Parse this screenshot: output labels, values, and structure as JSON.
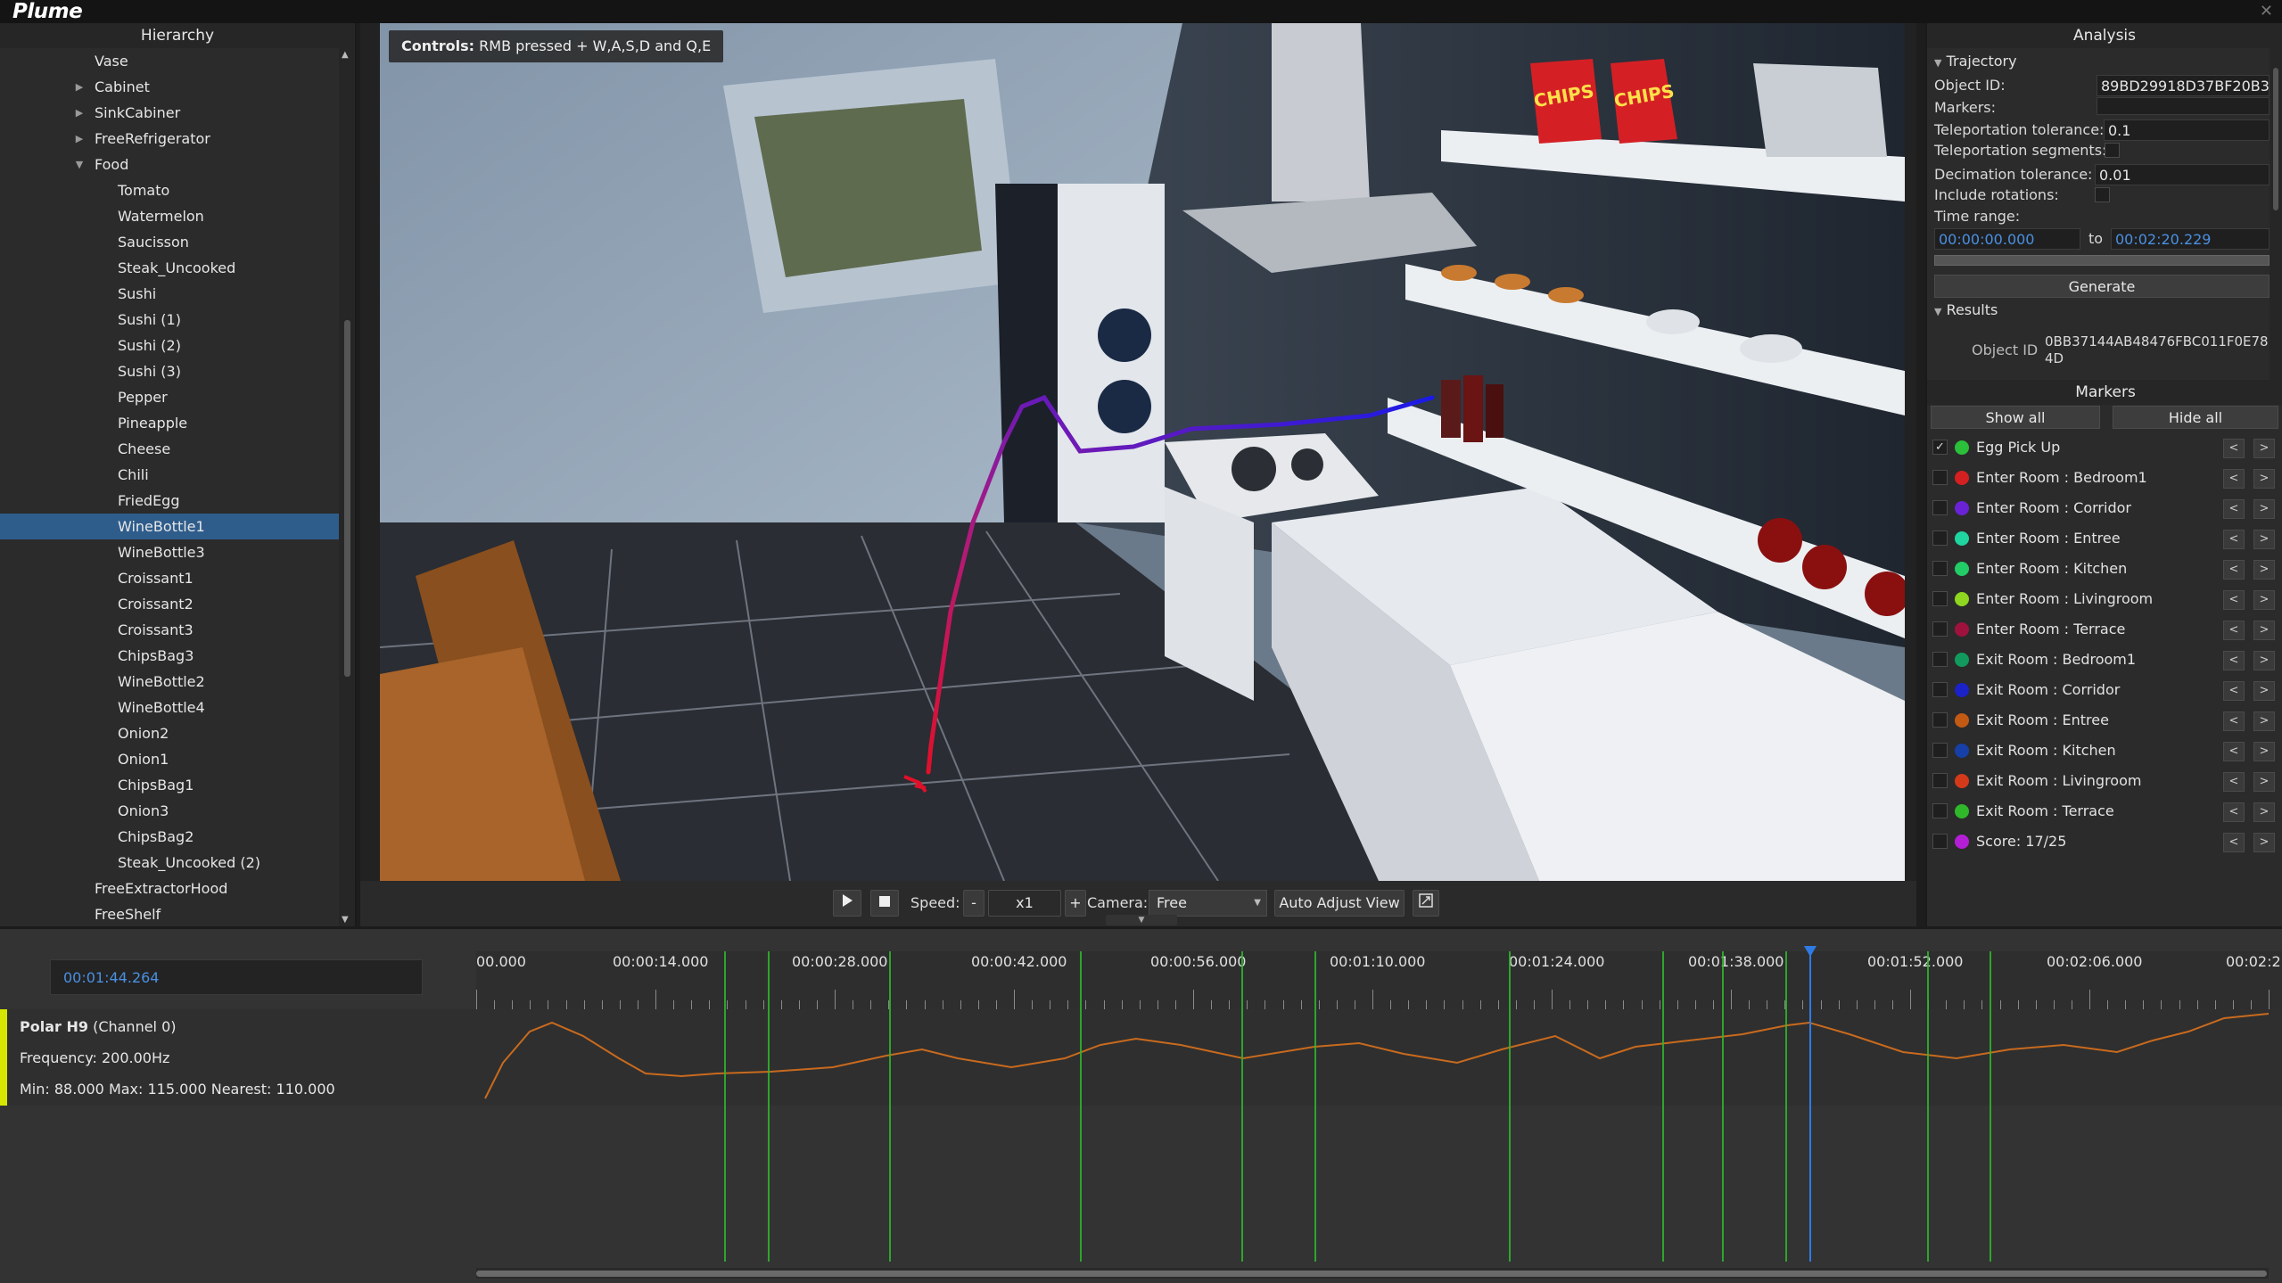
{
  "app": {
    "logo": "Plume"
  },
  "hierarchy": {
    "title": "Hierarchy",
    "items": [
      {
        "label": "Vase",
        "depth": 1,
        "arrow": ""
      },
      {
        "label": "Cabinet",
        "depth": 1,
        "arrow": "right"
      },
      {
        "label": "SinkCabiner",
        "depth": 1,
        "arrow": "right"
      },
      {
        "label": "FreeRefrigerator",
        "depth": 1,
        "arrow": "right"
      },
      {
        "label": "Food",
        "depth": 1,
        "arrow": "down"
      },
      {
        "label": "Tomato",
        "depth": 2,
        "arrow": ""
      },
      {
        "label": "Watermelon",
        "depth": 2,
        "arrow": ""
      },
      {
        "label": "Saucisson",
        "depth": 2,
        "arrow": ""
      },
      {
        "label": "Steak_Uncooked",
        "depth": 2,
        "arrow": ""
      },
      {
        "label": "Sushi",
        "depth": 2,
        "arrow": ""
      },
      {
        "label": "Sushi (1)",
        "depth": 2,
        "arrow": ""
      },
      {
        "label": "Sushi (2)",
        "depth": 2,
        "arrow": ""
      },
      {
        "label": "Sushi (3)",
        "depth": 2,
        "arrow": ""
      },
      {
        "label": "Pepper",
        "depth": 2,
        "arrow": ""
      },
      {
        "label": "Pineapple",
        "depth": 2,
        "arrow": ""
      },
      {
        "label": "Cheese",
        "depth": 2,
        "arrow": ""
      },
      {
        "label": "Chili",
        "depth": 2,
        "arrow": ""
      },
      {
        "label": "FriedEgg",
        "depth": 2,
        "arrow": ""
      },
      {
        "label": "WineBottle1",
        "depth": 2,
        "arrow": "",
        "selected": true
      },
      {
        "label": "WineBottle3",
        "depth": 2,
        "arrow": ""
      },
      {
        "label": "Croissant1",
        "depth": 2,
        "arrow": ""
      },
      {
        "label": "Croissant2",
        "depth": 2,
        "arrow": ""
      },
      {
        "label": "Croissant3",
        "depth": 2,
        "arrow": ""
      },
      {
        "label": "ChipsBag3",
        "depth": 2,
        "arrow": ""
      },
      {
        "label": "WineBottle2",
        "depth": 2,
        "arrow": ""
      },
      {
        "label": "WineBottle4",
        "depth": 2,
        "arrow": ""
      },
      {
        "label": "Onion2",
        "depth": 2,
        "arrow": ""
      },
      {
        "label": "Onion1",
        "depth": 2,
        "arrow": ""
      },
      {
        "label": "ChipsBag1",
        "depth": 2,
        "arrow": ""
      },
      {
        "label": "Onion3",
        "depth": 2,
        "arrow": ""
      },
      {
        "label": "ChipsBag2",
        "depth": 2,
        "arrow": ""
      },
      {
        "label": "Steak_Uncooked (2)",
        "depth": 2,
        "arrow": ""
      },
      {
        "label": "FreeExtractorHood",
        "depth": 1,
        "arrow": ""
      },
      {
        "label": "FreeShelf",
        "depth": 1,
        "arrow": ""
      }
    ]
  },
  "viewport": {
    "controls_bold": "Controls:",
    "controls_text": " RMB pressed + W,A,S,D and Q,E",
    "scene_text": {
      "chips": "CHIPS"
    },
    "toolbar": {
      "speed_label": "Speed:",
      "speed_minus": "-",
      "speed_value": "x1",
      "speed_plus": "+",
      "camera_label": "Camera:",
      "camera_value": "Free",
      "auto_adjust": "Auto Adjust View"
    }
  },
  "analysis": {
    "title": "Analysis",
    "trajectory": {
      "section": "Trajectory",
      "object_id_label": "Object ID:",
      "object_id_value": "89BD29918D37BF20B3",
      "markers_label": "Markers:",
      "teleport_tol_label": "Teleportation tolerance:",
      "teleport_tol_value": "0.1",
      "teleport_seg_label": "Teleportation segments:",
      "decimation_label": "Decimation tolerance:",
      "decimation_value": "0.01",
      "include_rot_label": "Include rotations:",
      "time_range_label": "Time range:",
      "time_from": "00:00:00.000",
      "to_label": "to",
      "time_to": "00:02:20.229",
      "generate_label": "Generate"
    },
    "results": {
      "section": "Results",
      "object_id_label": "Object ID",
      "object_id_value_line1": "0BB37144AB48476FBC011F0E78",
      "object_id_value_line2": "4D"
    },
    "markers": {
      "title": "Markers",
      "show_all": "Show all",
      "hide_all": "Hide all",
      "items": [
        {
          "label": "Egg Pick Up",
          "color": "#2bbf3a",
          "checked": true
        },
        {
          "label": "Enter Room : Bedroom1",
          "color": "#d42020",
          "checked": false
        },
        {
          "label": "Enter Room : Corridor",
          "color": "#6a22d6",
          "checked": false
        },
        {
          "label": "Enter Room : Entree",
          "color": "#1fd6a0",
          "checked": false
        },
        {
          "label": "Enter Room : Kitchen",
          "color": "#22cc66",
          "checked": false
        },
        {
          "label": "Enter Room : Livingroom",
          "color": "#8ed61f",
          "checked": false
        },
        {
          "label": "Enter Room : Terrace",
          "color": "#a0123e",
          "checked": false
        },
        {
          "label": "Exit Room : Bedroom1",
          "color": "#129a5e",
          "checked": false
        },
        {
          "label": "Exit Room : Corridor",
          "color": "#1a22c8",
          "checked": false
        },
        {
          "label": "Exit Room : Entree",
          "color": "#c25a14",
          "checked": false
        },
        {
          "label": "Exit Room : Kitchen",
          "color": "#1640a8",
          "checked": false
        },
        {
          "label": "Exit Room : Livingroom",
          "color": "#d43a1a",
          "checked": false
        },
        {
          "label": "Exit Room : Terrace",
          "color": "#2fb82a",
          "checked": false
        },
        {
          "label": "Score: 17/25",
          "color": "#b41fd6",
          "checked": false
        }
      ],
      "prev": "<",
      "next": ">"
    }
  },
  "timeline": {
    "current_time": "00:01:44.264",
    "ticks": [
      "00.000",
      "00:00:14.000",
      "00:00:28.000",
      "00:00:42.000",
      "00:00:56.000",
      "00:01:10.000",
      "00:01:24.000",
      "00:01:38.000",
      "00:01:52.000",
      "00:02:06.000",
      "00:02:2"
    ],
    "track": {
      "name": "Polar H9",
      "channel": " (Channel 0)",
      "frequency": "Frequency: 200.00Hz",
      "stats": "Min: 88.000 Max: 115.000 Nearest: 110.000",
      "color": "#d6e600",
      "line_color": "#c86a1e"
    },
    "playhead_color": "#2f7be6",
    "marker_line_color": "#2fb82a"
  }
}
